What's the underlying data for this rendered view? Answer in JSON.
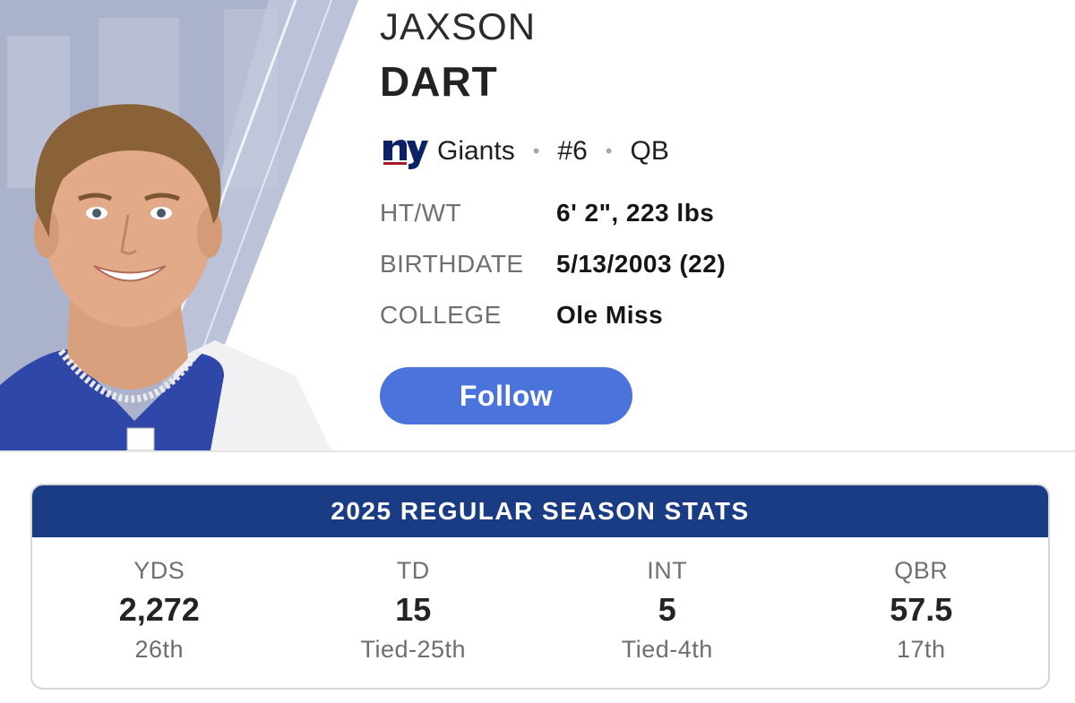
{
  "player": {
    "first_name": "JAXSON",
    "last_name": "DART",
    "team": "Giants",
    "team_logo_icon": "giants-ny-logo-icon",
    "number": "#6",
    "position": "QB",
    "separator": "•"
  },
  "bio": [
    {
      "label": "HT/WT",
      "value": "6' 2\", 223 lbs"
    },
    {
      "label": "BIRTHDATE",
      "value": "5/13/2003 (22)"
    },
    {
      "label": "COLLEGE",
      "value": "Ole Miss"
    }
  ],
  "follow_label": "Follow",
  "stats": {
    "title": "2025 REGULAR SEASON STATS",
    "items": [
      {
        "label": "YDS",
        "value": "2,272",
        "rank": "26th"
      },
      {
        "label": "TD",
        "value": "15",
        "rank": "Tied-25th"
      },
      {
        "label": "INT",
        "value": "5",
        "rank": "Tied-4th"
      },
      {
        "label": "QBR",
        "value": "57.5",
        "rank": "17th"
      }
    ]
  },
  "colors": {
    "accent": "#4a74db",
    "giants_blue": "#193c84",
    "headshot_bg": "#aab2cc"
  }
}
